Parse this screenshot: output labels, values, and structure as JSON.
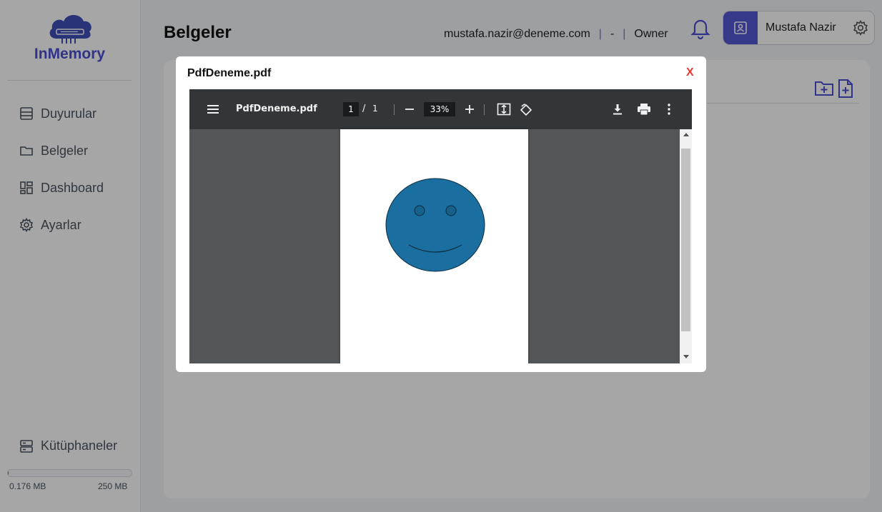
{
  "app": {
    "name": "InMemory"
  },
  "sidebar": {
    "items": [
      {
        "label": "Duyurular",
        "icon": "announcements-icon"
      },
      {
        "label": "Belgeler",
        "icon": "folder-icon"
      },
      {
        "label": "Dashboard",
        "icon": "dashboard-icon"
      },
      {
        "label": "Ayarlar",
        "icon": "gear-icon"
      }
    ],
    "library": {
      "label": "Kütüphaneler",
      "icon": "server-icon"
    },
    "storage": {
      "used": "0.176 MB",
      "total": "250 MB",
      "fraction": 0.0007
    }
  },
  "header": {
    "title": "Belgeler",
    "email": "mustafa.nazir@deneme.com",
    "separator_value": "-",
    "role": "Owner",
    "user_name": "Mustafa Nazir"
  },
  "modal": {
    "title": "PdfDeneme.pdf",
    "close_label": "X"
  },
  "pdf_viewer": {
    "file_name": "PdfDeneme.pdf",
    "current_page": "1",
    "page_separator": "/",
    "total_pages": "1",
    "zoom": "33%"
  },
  "colors": {
    "accent": "#5458d4",
    "close": "#e53935",
    "viewer_toolbar": "#323639",
    "viewer_bg": "#525659",
    "smiley_fill": "#1a6fa0"
  }
}
